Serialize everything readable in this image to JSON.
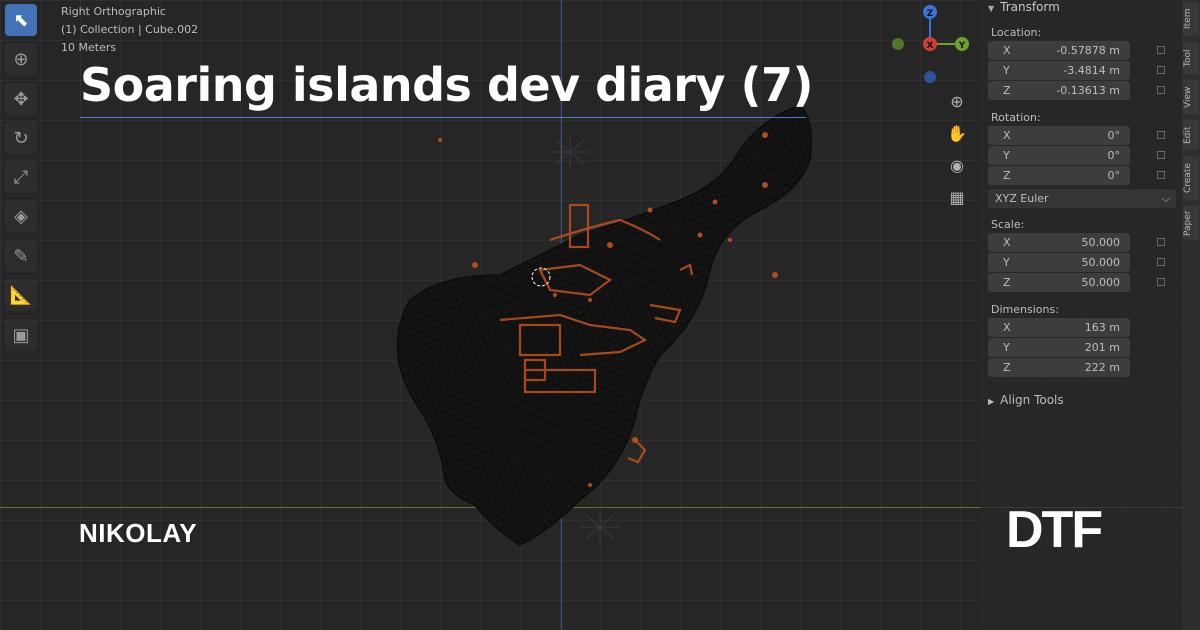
{
  "viewport": {
    "view_name": "Right Orthographic",
    "collection": "(1) Collection | Cube.002",
    "scale_text": "10 Meters"
  },
  "toolbar": {
    "tools": [
      "select-icon",
      "cursor-icon",
      "move-icon",
      "rotate-icon",
      "scale-icon",
      "transform-icon",
      "annotate-icon",
      "measure-icon",
      "add-cube-icon"
    ]
  },
  "gizmo": {
    "z": "Z",
    "x": "X",
    "y": "Y"
  },
  "transform_panel": {
    "header": "Transform",
    "location_label": "Location:",
    "location": [
      {
        "axis": "X",
        "value": "-0.57878 m"
      },
      {
        "axis": "Y",
        "value": "-3.4814 m"
      },
      {
        "axis": "Z",
        "value": "-0.13613 m"
      }
    ],
    "rotation_label": "Rotation:",
    "rotation": [
      {
        "axis": "X",
        "value": "0°"
      },
      {
        "axis": "Y",
        "value": "0°"
      },
      {
        "axis": "Z",
        "value": "0°"
      }
    ],
    "rotation_mode": "XYZ Euler",
    "scale_label": "Scale:",
    "scale": [
      {
        "axis": "X",
        "value": "50.000"
      },
      {
        "axis": "Y",
        "value": "50.000"
      },
      {
        "axis": "Z",
        "value": "50.000"
      }
    ],
    "dimensions_label": "Dimensions:",
    "dimensions": [
      {
        "axis": "X",
        "value": "163 m"
      },
      {
        "axis": "Y",
        "value": "201 m"
      },
      {
        "axis": "Z",
        "value": "222 m"
      }
    ],
    "align_tools": "Align Tools"
  },
  "side_tabs": [
    "Item",
    "Tool",
    "View",
    "Edit",
    "Create",
    "Paper"
  ],
  "overlay": {
    "title": "Soaring islands dev diary (7)",
    "author": "NIKOLAY",
    "brand": "DTF"
  },
  "colors": {
    "accent": "#4472b8",
    "mesh_highlight": "#c2521d",
    "axis_x": "#d33b3b",
    "axis_y": "#6ea32a",
    "axis_z": "#3b72d6"
  }
}
